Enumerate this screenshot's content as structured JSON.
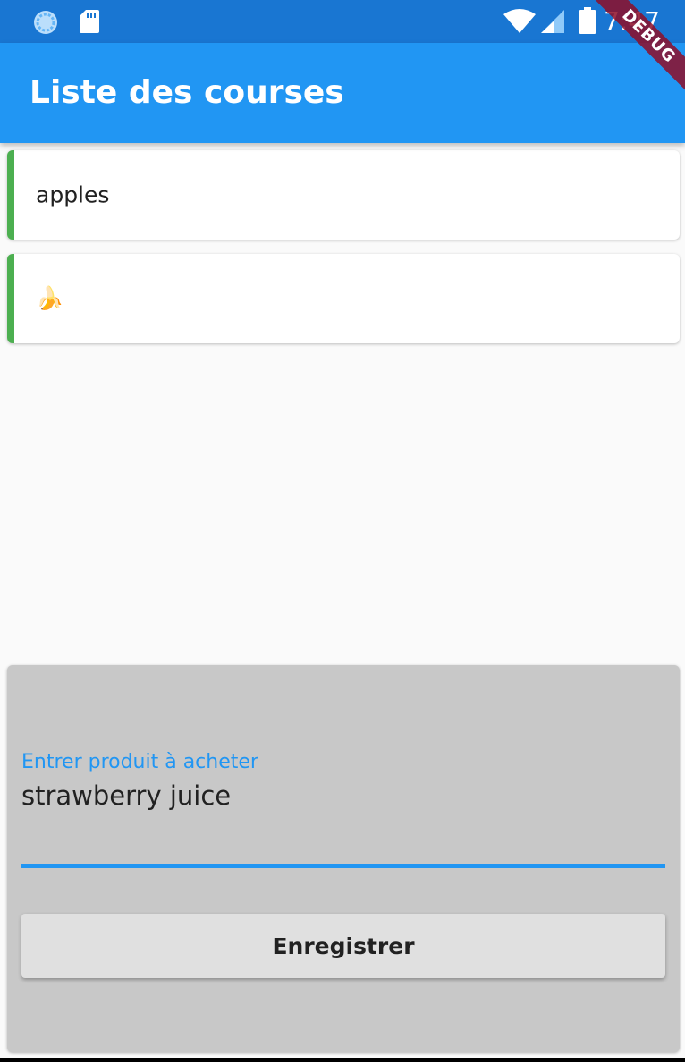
{
  "status_bar": {
    "time": "7:47",
    "icons": [
      "loading-icon",
      "sd-card-icon",
      "wifi-icon",
      "signal-icon",
      "battery-icon"
    ],
    "color": "#1976d2"
  },
  "app_bar": {
    "title": "Liste des courses",
    "color": "#2196f3",
    "debug_banner": "DEBUG"
  },
  "list": {
    "items": [
      {
        "label": "apples",
        "accent": "#4caf50"
      },
      {
        "label": "🍌",
        "accent": "#4caf50"
      }
    ]
  },
  "form": {
    "field_label": "Entrer produit à acheter",
    "field_value": "strawberry juice",
    "save_label": "Enregistrer",
    "accent": "#2196f3",
    "background": "#c8c8c8"
  }
}
